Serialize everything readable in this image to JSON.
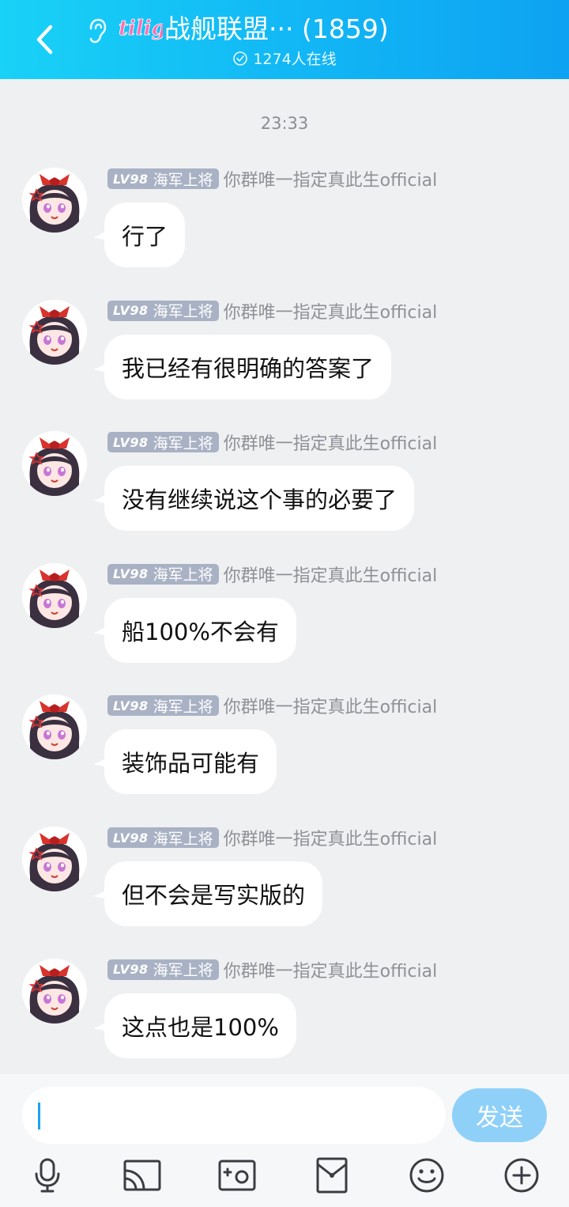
{
  "header": {
    "logo_text": "tilig",
    "title": "战舰联盟··· (1859)",
    "online_text": "1274人在线"
  },
  "chat": {
    "time": "23:33",
    "messages": [
      {
        "level": "LV98",
        "rank": "海军上将",
        "nickname": "你群唯一指定真此生official",
        "text": "行了"
      },
      {
        "level": "LV98",
        "rank": "海军上将",
        "nickname": "你群唯一指定真此生official",
        "text": "我已经有很明确的答案了"
      },
      {
        "level": "LV98",
        "rank": "海军上将",
        "nickname": "你群唯一指定真此生official",
        "text": "没有继续说这个事的必要了"
      },
      {
        "level": "LV98",
        "rank": "海军上将",
        "nickname": "你群唯一指定真此生official",
        "text": "船100%不会有"
      },
      {
        "level": "LV98",
        "rank": "海军上将",
        "nickname": "你群唯一指定真此生official",
        "text": "装饰品可能有"
      },
      {
        "level": "LV98",
        "rank": "海军上将",
        "nickname": "你群唯一指定真此生official",
        "text": "但不会是写实版的"
      },
      {
        "level": "LV98",
        "rank": "海军上将",
        "nickname": "你群唯一指定真此生official",
        "text": "这点也是100%"
      }
    ]
  },
  "input": {
    "value": "",
    "send_label": "发送"
  },
  "toolbar": {
    "icons": [
      "microphone-icon",
      "screen-cast-icon",
      "photo-icon",
      "red-packet-icon",
      "emoji-icon",
      "plus-icon"
    ]
  },
  "colors": {
    "header_start": "#19d2f7",
    "header_end": "#0ea2f2",
    "send_button": "#8fd0f9",
    "badge": "#a9b2c4",
    "chat_bg": "#eef0f2"
  }
}
